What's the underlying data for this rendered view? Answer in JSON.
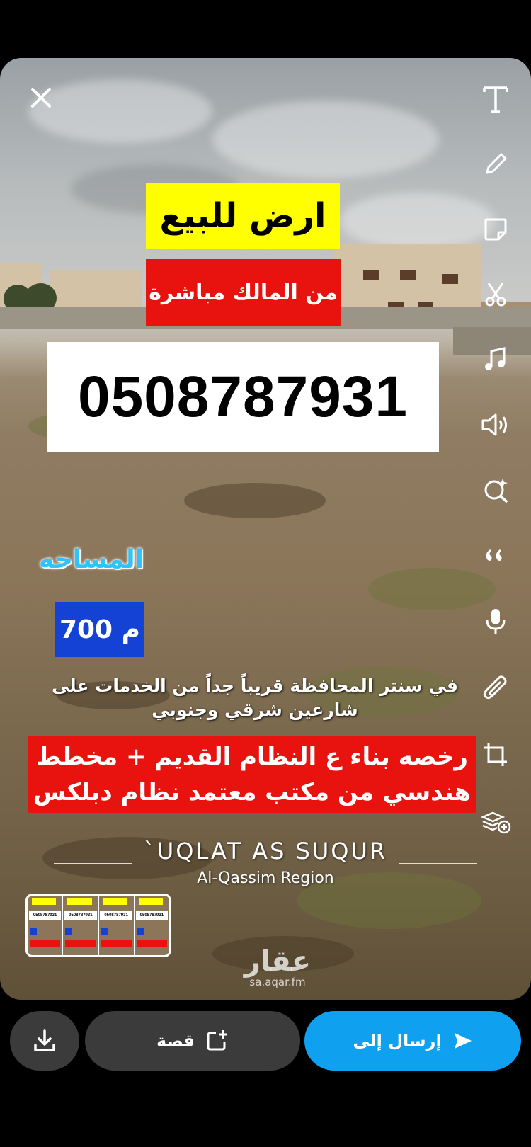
{
  "ad": {
    "title": "ارض للبيع",
    "subtitle": "من المالك مباشرة",
    "phone": "0508787931",
    "area_label": "المساحه",
    "area_value": "700 م",
    "description_line1": "في سنتر المحافظة قريباً جداً من الخدمات على",
    "description_line2": "شارعين شرقي وجنوبي",
    "banner_line1": "رخصه بناء ع النظام القديم + مخطط",
    "banner_line2": "هندسي من مكتب معتمد نظام دبلكس"
  },
  "location": {
    "title": "`UQLAT AS SUQUR",
    "region": "Al-Qassim Region"
  },
  "thumbnail": {
    "cell_text": "0508787931"
  },
  "watermark": {
    "logo": "عقار",
    "url": "sa.aqar.fm"
  },
  "toolbar": {
    "icons": [
      "text-icon",
      "pencil-icon",
      "sticker-icon",
      "scissors-icon",
      "music-icon",
      "volume-icon",
      "lens-search-icon",
      "quote-icon",
      "microphone-icon",
      "paperclip-icon",
      "crop-icon",
      "stack-add-icon"
    ]
  },
  "bottom": {
    "story_label": "قصة",
    "send_label": "إرسال إلى",
    "send_color": "#0fa1ef"
  }
}
